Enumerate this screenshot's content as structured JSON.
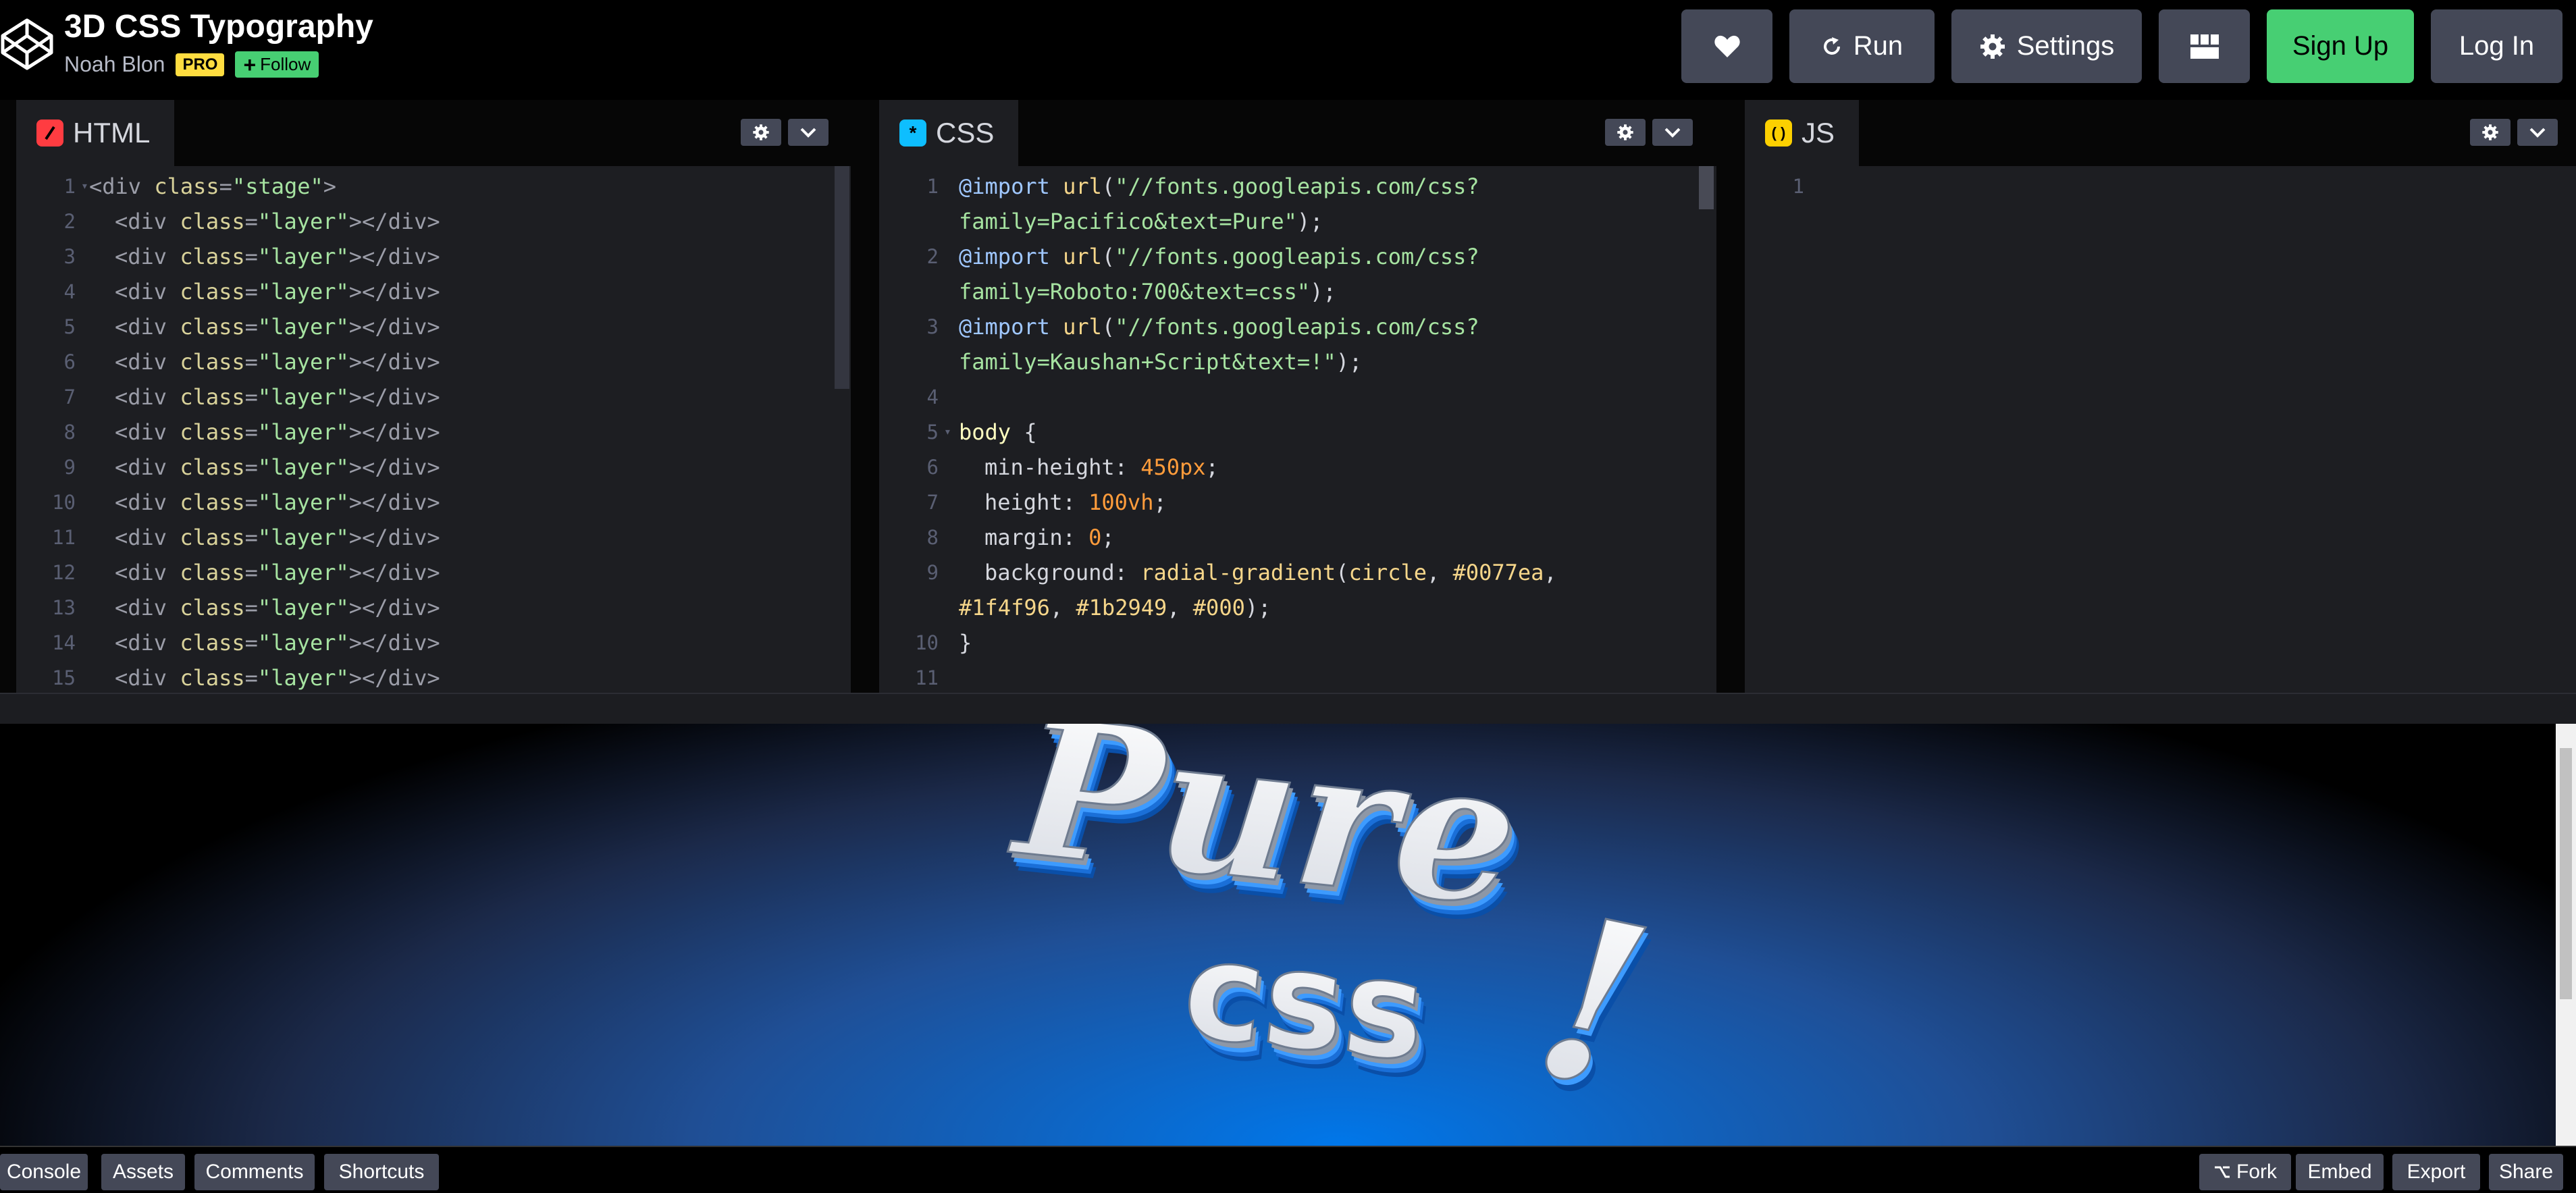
{
  "header": {
    "title": "3D CSS Typography",
    "author": "Noah Blon",
    "pro_badge": "PRO",
    "follow_label": "Follow",
    "run_label": "Run",
    "settings_label": "Settings",
    "signup_label": "Sign Up",
    "login_label": "Log In"
  },
  "editors": {
    "html": {
      "tab_label": "HTML",
      "tab_color": "#ff3c41",
      "lines": [
        {
          "n": "1",
          "fold": true,
          "indent": 0,
          "parts": [
            [
              "tag",
              "<div "
            ],
            [
              "attr",
              "class"
            ],
            [
              "tag",
              "="
            ],
            [
              "str",
              "\"stage\""
            ],
            [
              "tag",
              ">"
            ]
          ]
        },
        {
          "n": "2",
          "fold": false,
          "indent": 1,
          "parts": [
            [
              "tag",
              "<div "
            ],
            [
              "attr",
              "class"
            ],
            [
              "tag",
              "="
            ],
            [
              "str",
              "\"layer\""
            ],
            [
              "tag",
              "></div>"
            ]
          ]
        },
        {
          "n": "3",
          "fold": false,
          "indent": 1,
          "parts": [
            [
              "tag",
              "<div "
            ],
            [
              "attr",
              "class"
            ],
            [
              "tag",
              "="
            ],
            [
              "str",
              "\"layer\""
            ],
            [
              "tag",
              "></div>"
            ]
          ]
        },
        {
          "n": "4",
          "fold": false,
          "indent": 1,
          "parts": [
            [
              "tag",
              "<div "
            ],
            [
              "attr",
              "class"
            ],
            [
              "tag",
              "="
            ],
            [
              "str",
              "\"layer\""
            ],
            [
              "tag",
              "></div>"
            ]
          ]
        },
        {
          "n": "5",
          "fold": false,
          "indent": 1,
          "parts": [
            [
              "tag",
              "<div "
            ],
            [
              "attr",
              "class"
            ],
            [
              "tag",
              "="
            ],
            [
              "str",
              "\"layer\""
            ],
            [
              "tag",
              "></div>"
            ]
          ]
        },
        {
          "n": "6",
          "fold": false,
          "indent": 1,
          "parts": [
            [
              "tag",
              "<div "
            ],
            [
              "attr",
              "class"
            ],
            [
              "tag",
              "="
            ],
            [
              "str",
              "\"layer\""
            ],
            [
              "tag",
              "></div>"
            ]
          ]
        },
        {
          "n": "7",
          "fold": false,
          "indent": 1,
          "parts": [
            [
              "tag",
              "<div "
            ],
            [
              "attr",
              "class"
            ],
            [
              "tag",
              "="
            ],
            [
              "str",
              "\"layer\""
            ],
            [
              "tag",
              "></div>"
            ]
          ]
        },
        {
          "n": "8",
          "fold": false,
          "indent": 1,
          "parts": [
            [
              "tag",
              "<div "
            ],
            [
              "attr",
              "class"
            ],
            [
              "tag",
              "="
            ],
            [
              "str",
              "\"layer\""
            ],
            [
              "tag",
              "></div>"
            ]
          ]
        },
        {
          "n": "9",
          "fold": false,
          "indent": 1,
          "parts": [
            [
              "tag",
              "<div "
            ],
            [
              "attr",
              "class"
            ],
            [
              "tag",
              "="
            ],
            [
              "str",
              "\"layer\""
            ],
            [
              "tag",
              "></div>"
            ]
          ]
        },
        {
          "n": "10",
          "fold": false,
          "indent": 1,
          "parts": [
            [
              "tag",
              "<div "
            ],
            [
              "attr",
              "class"
            ],
            [
              "tag",
              "="
            ],
            [
              "str",
              "\"layer\""
            ],
            [
              "tag",
              "></div>"
            ]
          ]
        },
        {
          "n": "11",
          "fold": false,
          "indent": 1,
          "parts": [
            [
              "tag",
              "<div "
            ],
            [
              "attr",
              "class"
            ],
            [
              "tag",
              "="
            ],
            [
              "str",
              "\"layer\""
            ],
            [
              "tag",
              "></div>"
            ]
          ]
        },
        {
          "n": "12",
          "fold": false,
          "indent": 1,
          "parts": [
            [
              "tag",
              "<div "
            ],
            [
              "attr",
              "class"
            ],
            [
              "tag",
              "="
            ],
            [
              "str",
              "\"layer\""
            ],
            [
              "tag",
              "></div>"
            ]
          ]
        },
        {
          "n": "13",
          "fold": false,
          "indent": 1,
          "parts": [
            [
              "tag",
              "<div "
            ],
            [
              "attr",
              "class"
            ],
            [
              "tag",
              "="
            ],
            [
              "str",
              "\"layer\""
            ],
            [
              "tag",
              "></div>"
            ]
          ]
        },
        {
          "n": "14",
          "fold": false,
          "indent": 1,
          "parts": [
            [
              "tag",
              "<div "
            ],
            [
              "attr",
              "class"
            ],
            [
              "tag",
              "="
            ],
            [
              "str",
              "\"layer\""
            ],
            [
              "tag",
              "></div>"
            ]
          ]
        },
        {
          "n": "15",
          "fold": false,
          "indent": 1,
          "parts": [
            [
              "tag",
              "<div "
            ],
            [
              "attr",
              "class"
            ],
            [
              "tag",
              "="
            ],
            [
              "str",
              "\"layer\""
            ],
            [
              "tag",
              "></div>"
            ]
          ]
        }
      ]
    },
    "css": {
      "tab_label": "CSS",
      "tab_color": "#0ebeff",
      "lines": [
        {
          "n": "1",
          "fold": false,
          "indent": 0,
          "parts": [
            [
              "at",
              "@import "
            ],
            [
              "fn",
              "url"
            ],
            [
              "prop",
              "("
            ],
            [
              "str",
              "\"//fonts.googleapis.com/css?"
            ]
          ]
        },
        {
          "n": "",
          "fold": false,
          "indent": 0,
          "parts": [
            [
              "str",
              "family=Pacifico&text=Pure\""
            ],
            [
              "prop",
              ");"
            ]
          ]
        },
        {
          "n": "2",
          "fold": false,
          "indent": 0,
          "parts": [
            [
              "at",
              "@import "
            ],
            [
              "fn",
              "url"
            ],
            [
              "prop",
              "("
            ],
            [
              "str",
              "\"//fonts.googleapis.com/css?"
            ]
          ]
        },
        {
          "n": "",
          "fold": false,
          "indent": 0,
          "parts": [
            [
              "str",
              "family=Roboto:700&text=css\""
            ],
            [
              "prop",
              ");"
            ]
          ]
        },
        {
          "n": "3",
          "fold": false,
          "indent": 0,
          "parts": [
            [
              "at",
              "@import "
            ],
            [
              "fn",
              "url"
            ],
            [
              "prop",
              "("
            ],
            [
              "str",
              "\"//fonts.googleapis.com/css?"
            ]
          ]
        },
        {
          "n": "",
          "fold": false,
          "indent": 0,
          "parts": [
            [
              "str",
              "family=Kaushan+Script&text=!\""
            ],
            [
              "prop",
              ");"
            ]
          ]
        },
        {
          "n": "4",
          "fold": false,
          "indent": 0,
          "parts": []
        },
        {
          "n": "5",
          "fold": true,
          "indent": 0,
          "parts": [
            [
              "sel",
              "body "
            ],
            [
              "prop",
              "{"
            ]
          ]
        },
        {
          "n": "6",
          "fold": false,
          "indent": 1,
          "parts": [
            [
              "prop",
              "min-height: "
            ],
            [
              "num",
              "450px"
            ],
            [
              "prop",
              ";"
            ]
          ]
        },
        {
          "n": "7",
          "fold": false,
          "indent": 1,
          "parts": [
            [
              "prop",
              "height: "
            ],
            [
              "num",
              "100vh"
            ],
            [
              "prop",
              ";"
            ]
          ]
        },
        {
          "n": "8",
          "fold": false,
          "indent": 1,
          "parts": [
            [
              "prop",
              "margin: "
            ],
            [
              "num",
              "0"
            ],
            [
              "prop",
              ";"
            ]
          ]
        },
        {
          "n": "9",
          "fold": false,
          "indent": 1,
          "parts": [
            [
              "prop",
              "background: "
            ],
            [
              "fn",
              "radial-gradient"
            ],
            [
              "prop",
              "("
            ],
            [
              "fn",
              "circle"
            ],
            [
              "prop",
              ", "
            ],
            [
              "hex",
              "#0077ea"
            ],
            [
              "prop",
              ","
            ]
          ]
        },
        {
          "n": "",
          "fold": false,
          "indent": 0,
          "parts": [
            [
              "hex",
              "#1f4f96"
            ],
            [
              "prop",
              ", "
            ],
            [
              "hex",
              "#1b2949"
            ],
            [
              "prop",
              ", "
            ],
            [
              "hex",
              "#000"
            ],
            [
              "prop",
              ");"
            ]
          ]
        },
        {
          "n": "10",
          "fold": false,
          "indent": 0,
          "parts": [
            [
              "prop",
              "}"
            ]
          ]
        },
        {
          "n": "11",
          "fold": false,
          "indent": 0,
          "parts": []
        }
      ]
    },
    "js": {
      "tab_label": "JS",
      "tab_color": "#fcd000",
      "lines": [
        {
          "n": "1",
          "fold": false,
          "indent": 0,
          "parts": []
        }
      ]
    }
  },
  "preview": {
    "word1": "Pure",
    "word2": "css",
    "word3": "!"
  },
  "footer": {
    "console": "Console",
    "assets": "Assets",
    "comments": "Comments",
    "shortcuts": "Shortcuts",
    "fork": "Fork",
    "embed": "Embed",
    "export": "Export",
    "share": "Share"
  }
}
